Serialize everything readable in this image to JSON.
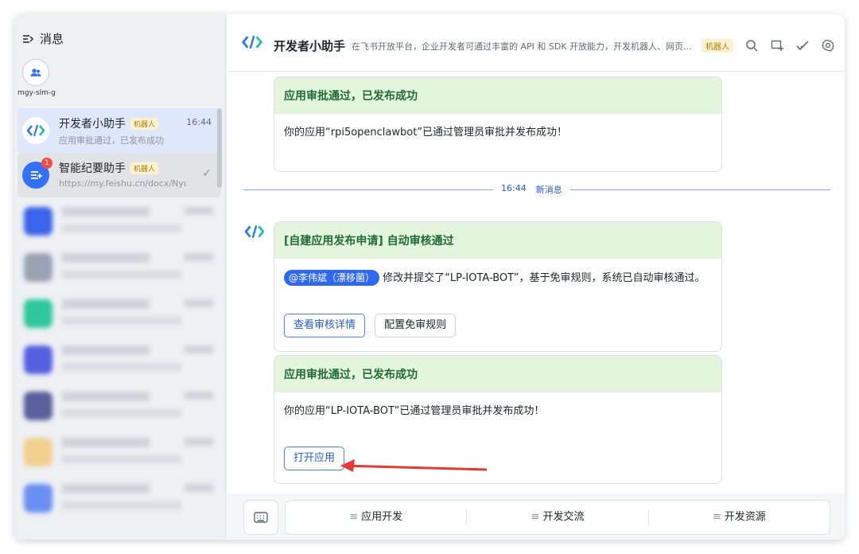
{
  "sidebar": {
    "header_label": "消息",
    "workspace_label": "mgy-slm-g",
    "chats": [
      {
        "name": "开发者小助手",
        "tag": "机器人",
        "time": "16:44",
        "preview": "应用审批通过，已发布成功"
      },
      {
        "name": "智能纪要助手",
        "tag": "机器人",
        "badge": "1",
        "preview": "https://my.feishu.cn/docx/Nyus"
      }
    ]
  },
  "topbar": {
    "title": "开发者小助手",
    "description": "在飞书开放平台，企业开发者可通过丰富的 API 和 SDK 开放能力，开发机器人、网页...",
    "tag": "机器人"
  },
  "messages": {
    "card1": {
      "header": "应用审批通过，已发布成功",
      "body": "你的应用“rpi5openclawbot”已通过管理员审批并发布成功！"
    },
    "divider": {
      "time": "16:44",
      "label": "新消息"
    },
    "card2": {
      "header": "[自建应用发布申请] 自动审核通过",
      "mention": "@李伟斌（漂移菌）",
      "body": "修改并提交了“LP-IOTA-BOT”，基于免审规则，系统已自动审核通过。",
      "btn_view": "查看审核详情",
      "btn_config": "配置免审规则"
    },
    "card3": {
      "header": "应用审批通过，已发布成功",
      "body": "你的应用“LP-IOTA-BOT”已通过管理员审批并发布成功！",
      "btn_open": "打开应用"
    }
  },
  "bottombar": {
    "items": [
      "应用开发",
      "开发交流",
      "开发资源"
    ]
  },
  "colors": {
    "accent": "#3370ff",
    "card_header": "#e3f5dd",
    "tag_bg": "#fdf1cf",
    "arrow": "#e53935"
  }
}
